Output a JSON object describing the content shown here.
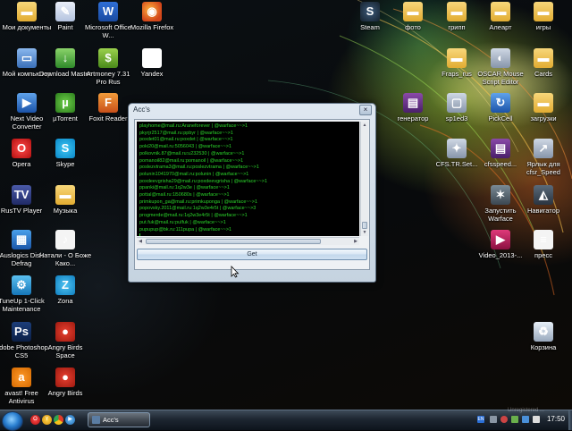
{
  "desktop": {
    "icons": [
      {
        "label": "Мои документы",
        "icon": "folder-icon"
      },
      {
        "label": "Paint",
        "icon": "paint-icon"
      },
      {
        "label": "Microsoft Office W...",
        "icon": "word-icon"
      },
      {
        "label": "Mozilla Firefox",
        "icon": "firefox-icon"
      },
      {
        "label": "Мой компьютер",
        "icon": "computer-icon"
      },
      {
        "label": "Download Master",
        "icon": "download-master-icon"
      },
      {
        "label": "Artmoney 7.31 Pro Rus",
        "icon": "artmoney-icon"
      },
      {
        "label": "Yandex",
        "icon": "yandex-icon"
      },
      {
        "label": "Next Video Converter",
        "icon": "video-converter-icon"
      },
      {
        "label": "µTorrent",
        "icon": "utorrent-icon"
      },
      {
        "label": "Foxit Reader",
        "icon": "foxit-icon"
      },
      {
        "label": "Opera",
        "icon": "opera-icon"
      },
      {
        "label": "Skype",
        "icon": "skype-icon"
      },
      {
        "label": "RusTV Player",
        "icon": "rustv-icon"
      },
      {
        "label": "Музыка",
        "icon": "folder-icon"
      },
      {
        "label": "Auslogics Disk Defrag",
        "icon": "defrag-icon"
      },
      {
        "label": "Натали - О Боже Како...",
        "icon": "document-icon"
      },
      {
        "label": "TuneUp 1-Click Maintenance",
        "icon": "tuneup-icon"
      },
      {
        "label": "Zona",
        "icon": "zona-icon"
      },
      {
        "label": "Adobe Photoshop CS5",
        "icon": "photoshop-icon"
      },
      {
        "label": "Angry Birds Space",
        "icon": "angry-birds-icon"
      },
      {
        "label": "avast! Free Antivirus",
        "icon": "avast-icon"
      },
      {
        "label": "Angry Birds",
        "icon": "angry-birds-icon"
      },
      {
        "label": "Steam",
        "icon": "steam-icon"
      },
      {
        "label": "фото",
        "icon": "folder-icon"
      },
      {
        "label": "грипп",
        "icon": "folder-icon"
      },
      {
        "label": "Алеарт",
        "icon": "folder-icon"
      },
      {
        "label": "игры",
        "icon": "folder-icon"
      },
      {
        "label": "Fraps_rus",
        "icon": "folder-icon"
      },
      {
        "label": "OSCAR Mouse Script Editor",
        "icon": "oscar-icon"
      },
      {
        "label": "Cards",
        "icon": "folder-icon"
      },
      {
        "label": "генератор",
        "icon": "winrar-icon"
      },
      {
        "label": "sp1ed3",
        "icon": "exe-icon"
      },
      {
        "label": "PickCell",
        "icon": "app-icon"
      },
      {
        "label": "загрузки",
        "icon": "folder-icon"
      },
      {
        "label": "CFS.TR.Set...",
        "icon": "exe-icon"
      },
      {
        "label": "cfsspeed...",
        "icon": "winrar-icon"
      },
      {
        "label": "Ярлык для cfsr_Speed",
        "icon": "shortcut-icon"
      },
      {
        "label": "Запустить Warface",
        "icon": "warface-icon"
      },
      {
        "label": "Навигатор",
        "icon": "navigator-icon"
      },
      {
        "label": "Video_2013-...",
        "icon": "video-icon"
      },
      {
        "label": "пресс",
        "icon": "document-icon"
      },
      {
        "label": "Корзина",
        "icon": "recycle-bin-icon"
      }
    ]
  },
  "window": {
    "title": "Acc's",
    "close_label": "×",
    "output_lines": [
      "playhome@mail.ru:Araneforever | @warface~~>1",
      "pkyrjr2517@mail.ru:ppbyr | @warface~~>1",
      "poxdet01@mail.ru:poxdet | @warface~~>1",
      "poki20@mail.ru:5056043 | @warface~~>1",
      "polkovnik.87@mail.ru:u232530 | @warface~~>1",
      "pomanoil82@mail.ru:pomanoil | @warface~~>1",
      "poslezvtrama3@mail.ru:poslezvtrama | @warface~~>1",
      "polunin1041970@mail.ru:polunin | @warface~~>1",
      "poxdeevgrisha29@mail.ru:poxdeevgrisha | @warface~~>1",
      "ppanki@mail.ru:1q2w3e | @warface~~>1",
      "pottal@mail.ru:1Б0680s | @warface~~>1",
      "primkupon_ga@mail.ru:primkuponga | @warface~~>1",
      "popovsky.2011@mail.ru:1q2w3e4r5t | @warface~~>3",
      "progmerde@mail.ru:1q2w3e4r5t | @warface~~>1",
      "put.fuk@mail.ru:pulfuk | @warface~~>1",
      "pupupup@bk.ru:111pupa | @warface~~>1"
    ],
    "get_button_label": "Get"
  },
  "taskbar": {
    "task_label": "Acc's",
    "lang": "EN",
    "clock": "17:50",
    "watermark": "Unregistered ..."
  }
}
